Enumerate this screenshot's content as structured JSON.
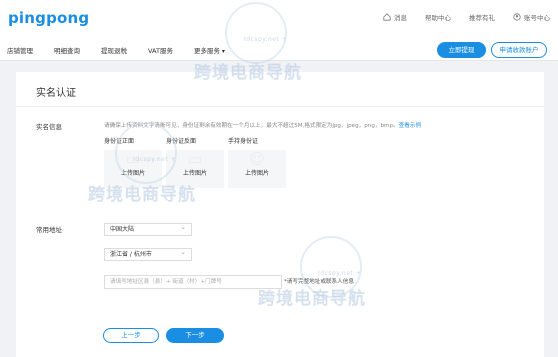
{
  "header": {
    "logo": "pingpong",
    "links": [
      {
        "icon": "home-icon",
        "label": "消息"
      },
      {
        "icon": "",
        "label": "帮助中心"
      },
      {
        "icon": "",
        "label": "推荐有礼"
      },
      {
        "icon": "user-icon",
        "label": "账号中心"
      }
    ]
  },
  "nav": {
    "items": [
      "店铺管理",
      "明细查询",
      "提现退税",
      "VAT服务",
      "更多服务"
    ],
    "btn_withdraw": "立即提现",
    "btn_apply": "申请收款账户"
  },
  "page": {
    "title": "实名认证",
    "id_section_label": "实名信息",
    "hint": "请确保上传资料文字清晰可见，身份证剩余有效期在一个月以上，最大不超过5M,格式限定为jpg，jpeg，png，bmp。",
    "hint_link": "查看示例",
    "uploads": [
      {
        "caption": "身份证正面",
        "button": "上传图片"
      },
      {
        "caption": "身份证反面",
        "button": "上传图片"
      },
      {
        "caption": "手持身份证",
        "button": "上传图片"
      }
    ],
    "address_label": "常用地址",
    "country_value": "中国大陆",
    "region_value": "浙江省 / 杭州市",
    "detail_placeholder": "请填写地址区县（县）+ 街道（村）+门牌号",
    "address_note": "*请写完整地址或联系人信息",
    "btn_prev": "上一步",
    "btn_next": "下一步"
  },
  "watermark": {
    "text": "跨境电商导航",
    "sub": "Idcspy.net +"
  },
  "colors": {
    "accent": "#1a8ee3",
    "canvas": "#f1f2f5"
  }
}
